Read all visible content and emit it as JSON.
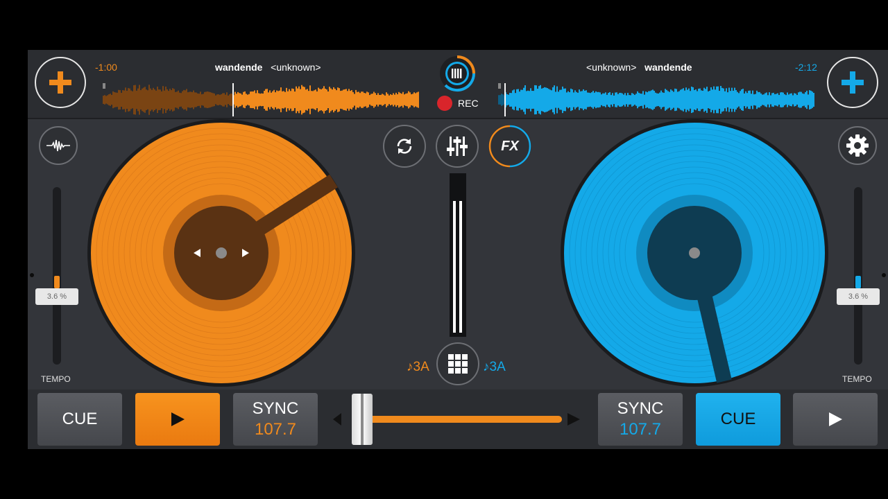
{
  "colors": {
    "orange": "#f08a1d",
    "blue": "#14a9e8",
    "panel": "#33353a",
    "topbar": "#2b2d31",
    "rec": "#d9252b"
  },
  "deck_left": {
    "time_remaining": "-1:00",
    "title": "wandende",
    "artist": "<unknown>",
    "tempo_value": "3.6 %",
    "tempo_label": "TEMPO",
    "cue_label": "CUE",
    "sync_label": "SYNC",
    "bpm": "107.7",
    "key": "♪3A",
    "playhead_fraction": 0.41
  },
  "deck_right": {
    "time_remaining": "-2:12",
    "title": "wandende",
    "artist": "<unknown>",
    "tempo_value": "3.6 %",
    "tempo_label": "TEMPO",
    "cue_label": "CUE",
    "sync_label": "SYNC",
    "bpm": "107.7",
    "key": "♪3A",
    "playhead_fraction": 0.02
  },
  "center": {
    "rec_label": "REC",
    "fx_label": "FX",
    "crossfader_fraction": 0.05
  },
  "icons": [
    "add-track-icon",
    "waveform-icon",
    "loop-icon",
    "mixer-icon",
    "fx-icon",
    "settings-icon",
    "sampler-grid-icon",
    "play-icon",
    "record-icon",
    "pitch-bend-left-icon",
    "pitch-bend-right-icon"
  ]
}
